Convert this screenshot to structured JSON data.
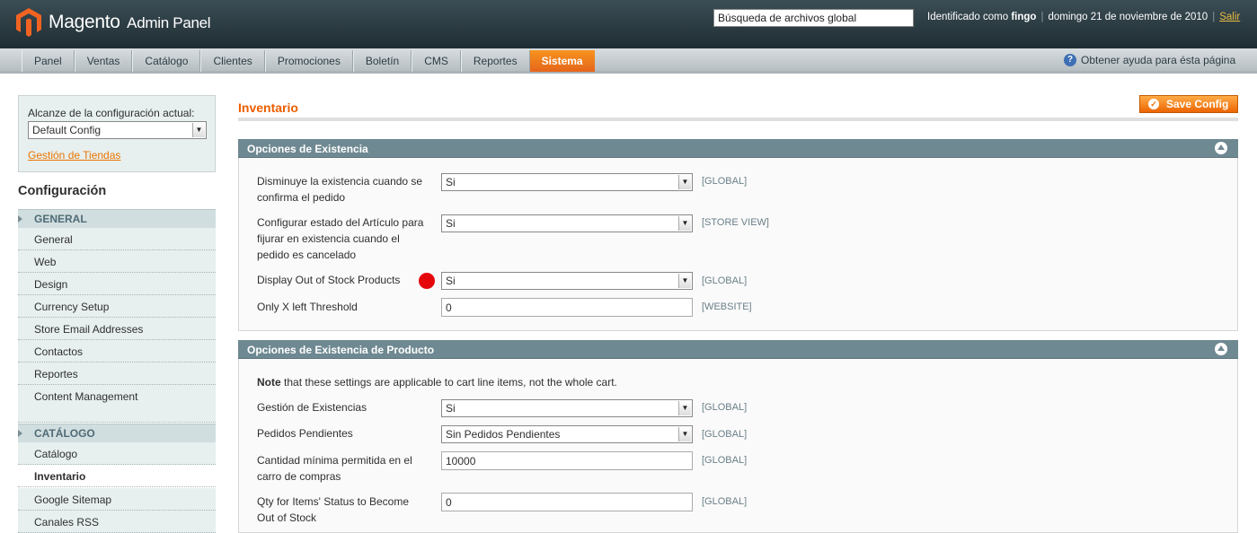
{
  "header": {
    "logo_main": "Magento",
    "logo_sub": "Admin Panel",
    "search_value": "Búsqueda de archivos global",
    "logged_prefix": "Identificado como",
    "user": "fingo",
    "date": "domingo 21 de noviembre de 2010",
    "logout": "Salir"
  },
  "nav": {
    "items": [
      "Panel",
      "Ventas",
      "Catálogo",
      "Clientes",
      "Promociones",
      "Boletín",
      "CMS",
      "Reportes",
      "Sistema"
    ],
    "help": "Obtener ayuda para ésta página"
  },
  "sidebar": {
    "scope_label": "Alcanze de la configuración actual:",
    "scope_value": "Default Config",
    "scope_link": "Gestión de Tiendas",
    "config_title": "Configuración",
    "general_head": "GENERAL",
    "general_items": [
      "General",
      "Web",
      "Design",
      "Currency Setup",
      "Store Email Addresses",
      "Contactos",
      "Reportes",
      "Content Management"
    ],
    "catalog_head": "CATÁLOGO",
    "catalog_items": [
      "Catálogo",
      "Inventario",
      "Google Sitemap",
      "Canales RSS"
    ]
  },
  "main": {
    "title": "Inventario",
    "save_button": "Save Config",
    "fieldset1": {
      "title": "Opciones de Existencia",
      "rows": [
        {
          "label": "Disminuye la existencia cuando se confirma el pedido",
          "value": "Si",
          "scope": "[GLOBAL]"
        },
        {
          "label": "Configurar estado del Artículo para fijurar en existencia cuando el pedido es cancelado",
          "value": "Si",
          "scope": "[STORE VIEW]"
        },
        {
          "label": "Display Out of Stock Products",
          "value": "Si",
          "scope": "[GLOBAL]"
        },
        {
          "label": "Only X left Threshold",
          "value": "0",
          "scope": "[WEBSITE]"
        }
      ]
    },
    "fieldset2": {
      "title": "Opciones de Existencia de Producto",
      "note_bold": "Note",
      "note_rest": " that these settings are applicable to cart line items, not the whole cart.",
      "rows": [
        {
          "label": "Gestión de Existencias",
          "value": "Si",
          "scope": "[GLOBAL]"
        },
        {
          "label": "Pedidos Pendientes",
          "value": "Sin Pedidos Pendientes",
          "scope": "[GLOBAL]"
        },
        {
          "label": "Cantidad mínima permitida en el carro de compras",
          "value": "10000",
          "scope": "[GLOBAL]"
        },
        {
          "label": "Qty for Items' Status to Become Out of Stock",
          "value": "0",
          "scope": "[GLOBAL]"
        }
      ]
    }
  },
  "colors": {
    "accent": "#eb5e00",
    "header_bg": "#2b3b42",
    "fieldset_head": "#6f8992",
    "marker": "#e5060b"
  }
}
